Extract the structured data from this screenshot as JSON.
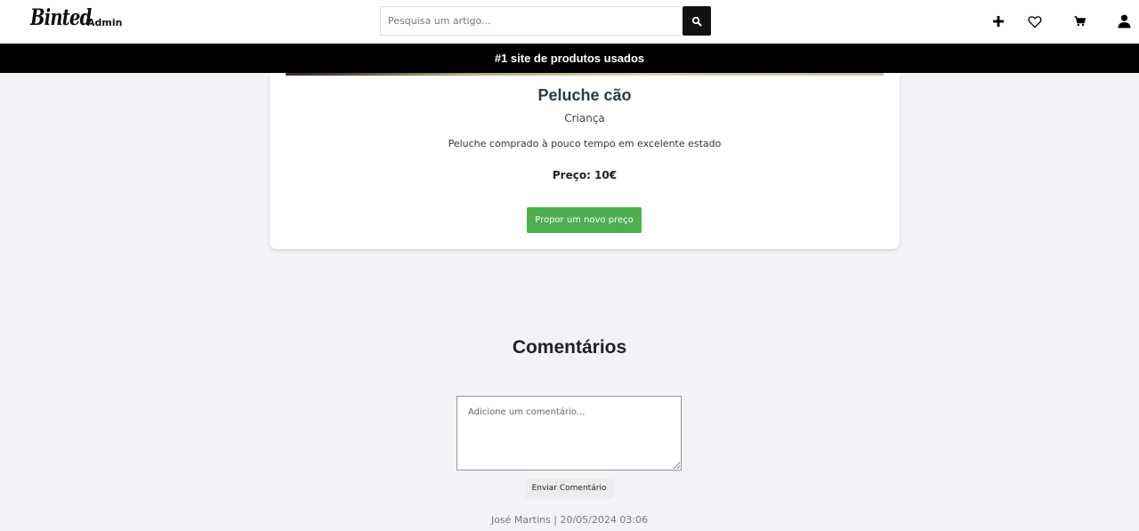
{
  "header": {
    "logo": "Binted",
    "admin_label": "Admin",
    "search": {
      "placeholder": "Pesquisa um artigo...",
      "button_icon": "search-icon"
    },
    "icons": [
      "plus-icon",
      "heart-icon",
      "cart-icon",
      "user-icon"
    ]
  },
  "banner": {
    "text": "#1 site de produtos usados"
  },
  "product": {
    "title": "Peluche cão",
    "category": "Criança",
    "description": "Peluche comprado à pouco tempo em excelente estado",
    "price": "Preço: 10€",
    "offer_button": "Propor um novo preço",
    "accent_color": "#4caf50"
  },
  "comments": {
    "title": "Comentários",
    "textarea_placeholder": "Adicione um comentário...",
    "send_button": "Enviar Comentário",
    "items": [
      {
        "meta": "José Martins | 20/05/2024 03:06"
      }
    ]
  }
}
